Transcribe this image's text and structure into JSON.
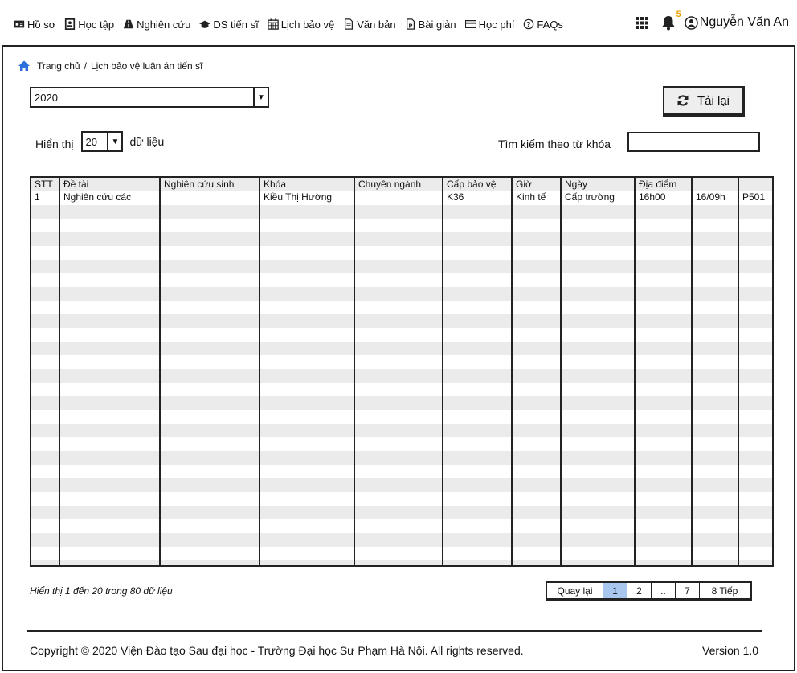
{
  "nav": {
    "items": [
      {
        "label": "Hồ sơ",
        "icon": "id-card-icon"
      },
      {
        "label": "Học tập",
        "icon": "user-book-icon"
      },
      {
        "label": "Nghiên cứu",
        "icon": "road-icon"
      },
      {
        "label": "DS tiến sĩ",
        "icon": "graduation-cap-icon"
      },
      {
        "label": "Lịch bảo vệ",
        "icon": "calendar-icon"
      },
      {
        "label": "Văn bản",
        "icon": "document-icon"
      },
      {
        "label": "Bài giản",
        "icon": "slide-icon"
      },
      {
        "label": "Học phí",
        "icon": "credit-card-icon"
      },
      {
        "label": "FAQs",
        "icon": "question-circle-icon"
      }
    ],
    "notification_count": "5",
    "user_name": "Nguyễn Văn An"
  },
  "breadcrumb": {
    "home": "Trang chủ",
    "separator": "/",
    "current": "Lịch bảo vệ luận án tiến sĩ"
  },
  "filters": {
    "year": "2020",
    "reload_label": "Tải lại",
    "show_label": "Hiển thị",
    "entries": "20",
    "entries_suffix": "dữ liệu",
    "search_label": "Tìm kiếm theo từ khóa",
    "search_value": ""
  },
  "table": {
    "headers": [
      "STT",
      "Đề tài",
      "Nghiên cứu sinh",
      "Khóa",
      "Chuyên ngành",
      "Cấp bảo vệ",
      "Giờ",
      "Ngày",
      "Địa điểm",
      "",
      ""
    ],
    "rows": [
      [
        "1",
        "Nghiên cứu các",
        "",
        "Kiều Thị Hường",
        "",
        "K36",
        "Kinh tế",
        "Cấp trường",
        "16h00",
        "16/09h",
        "P501"
      ]
    ]
  },
  "footer": {
    "info": "Hiển thị 1 đến 20 trong 80 dữ liệu",
    "pager": [
      "Quay lại",
      "1",
      "2",
      "..",
      "7",
      "8 Tiếp"
    ],
    "active_page": "1",
    "copyright": "Copyright © 2020 Viện Đào tạo Sau đại học - Trường Đại học Sư Phạm Hà Nội. All rights reserved.",
    "version": "Version 1.0"
  },
  "colors": {
    "active_page": "#a9c7ee",
    "stripe": "#ebebeb",
    "badge": "#e6a000",
    "home_icon": "#2a6fdb"
  }
}
